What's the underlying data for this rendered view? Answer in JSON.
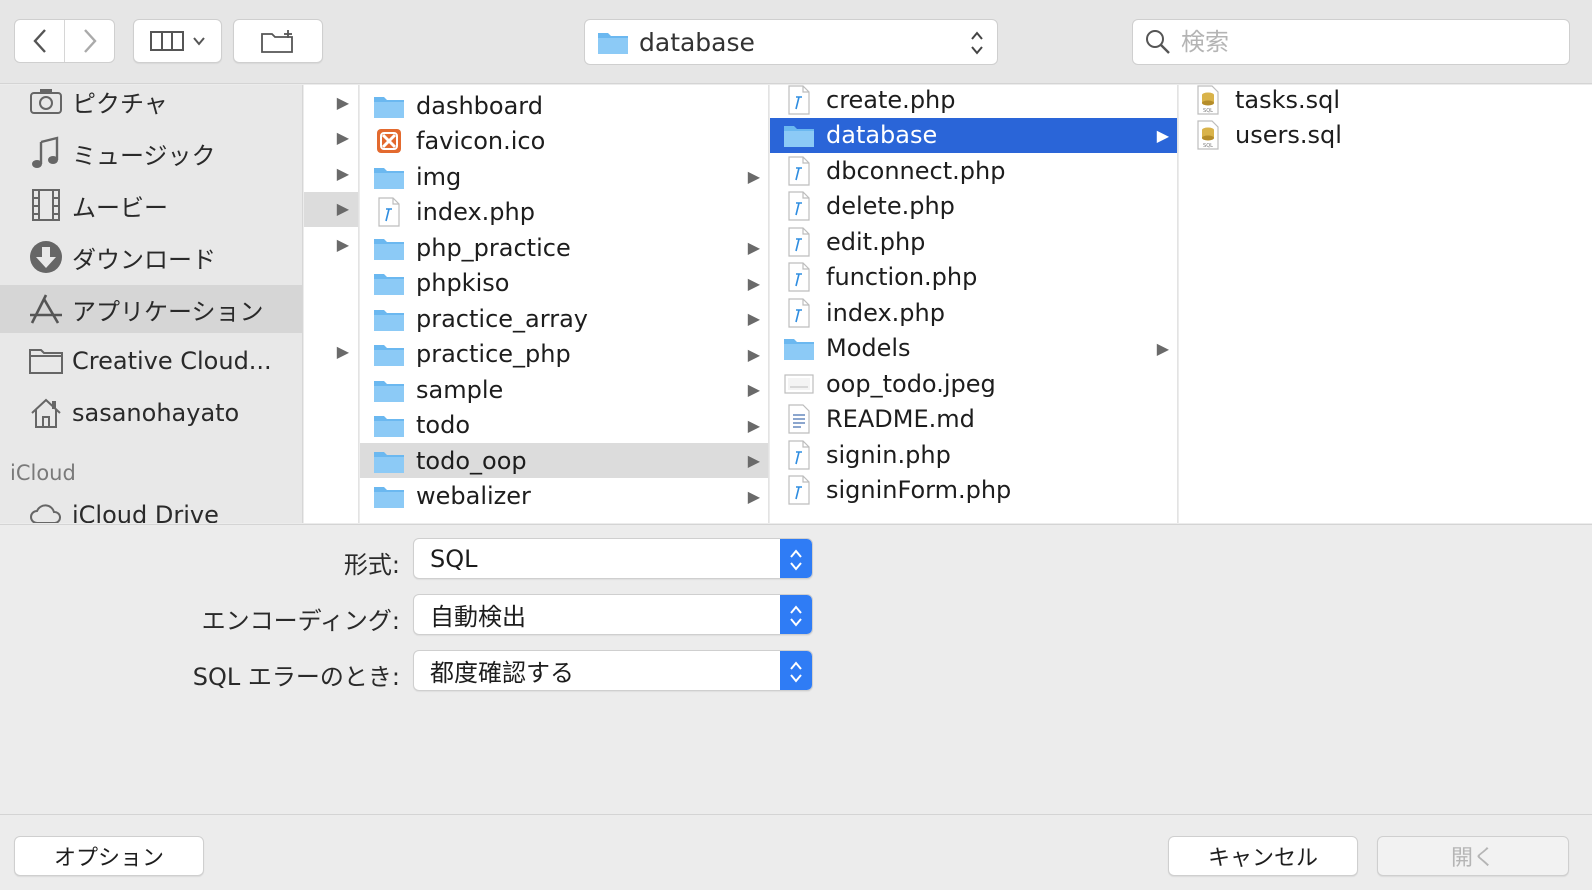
{
  "toolbar": {
    "path_label": "database",
    "search_placeholder": "検索"
  },
  "sidebar": {
    "items": [
      {
        "label": "ピクチャ",
        "icon": "camera-icon"
      },
      {
        "label": "ミュージック",
        "icon": "music-note-icon"
      },
      {
        "label": "ムービー",
        "icon": "film-icon"
      },
      {
        "label": "ダウンロード",
        "icon": "download-icon"
      },
      {
        "label": "アプリケーション",
        "icon": "applications-icon",
        "selected": true
      },
      {
        "label": "Creative Cloud...",
        "icon": "folder-icon"
      },
      {
        "label": "sasanohayato",
        "icon": "home-icon"
      }
    ],
    "section_icloud": "iCloud",
    "icloud_item": "iCloud Drive"
  },
  "column2": [
    {
      "name": "dashboard",
      "type": "folder",
      "arrow": false
    },
    {
      "name": "favicon.ico",
      "type": "xampp",
      "arrow": false
    },
    {
      "name": "img",
      "type": "folder",
      "arrow": true
    },
    {
      "name": "index.php",
      "type": "php",
      "arrow": false
    },
    {
      "name": "php_practice",
      "type": "folder",
      "arrow": true
    },
    {
      "name": "phpkiso",
      "type": "folder",
      "arrow": true
    },
    {
      "name": "practice_array",
      "type": "folder",
      "arrow": true
    },
    {
      "name": "practice_php",
      "type": "folder",
      "arrow": true
    },
    {
      "name": "sample",
      "type": "folder",
      "arrow": true
    },
    {
      "name": "todo",
      "type": "folder",
      "arrow": true
    },
    {
      "name": "todo_oop",
      "type": "folder",
      "arrow": true,
      "highlight": true
    },
    {
      "name": "webalizer",
      "type": "folder",
      "arrow": true
    }
  ],
  "column3": [
    {
      "name": "create.php",
      "type": "php"
    },
    {
      "name": "database",
      "type": "folder",
      "arrow": true,
      "selected": true
    },
    {
      "name": "dbconnect.php",
      "type": "php"
    },
    {
      "name": "delete.php",
      "type": "php"
    },
    {
      "name": "edit.php",
      "type": "php"
    },
    {
      "name": "function.php",
      "type": "php"
    },
    {
      "name": "index.php",
      "type": "php"
    },
    {
      "name": "Models",
      "type": "folder",
      "arrow": true
    },
    {
      "name": "oop_todo.jpeg",
      "type": "image"
    },
    {
      "name": "README.md",
      "type": "text"
    },
    {
      "name": "signin.php",
      "type": "php"
    },
    {
      "name": "signinForm.php",
      "type": "php"
    }
  ],
  "column4": [
    {
      "name": "tasks.sql",
      "type": "sql"
    },
    {
      "name": "users.sql",
      "type": "sql"
    }
  ],
  "options": {
    "format_label": "形式:",
    "format_value": "SQL",
    "encoding_label": "エンコーディング:",
    "encoding_value": "自動検出",
    "error_label": "SQL エラーのとき:",
    "error_value": "都度確認する"
  },
  "buttons": {
    "options": "オプション",
    "cancel": "キャンセル",
    "open": "開く"
  },
  "colors": {
    "selection": "#2a65d8",
    "folder": "#6bb8f0",
    "stepper": "#2f7cf5"
  }
}
